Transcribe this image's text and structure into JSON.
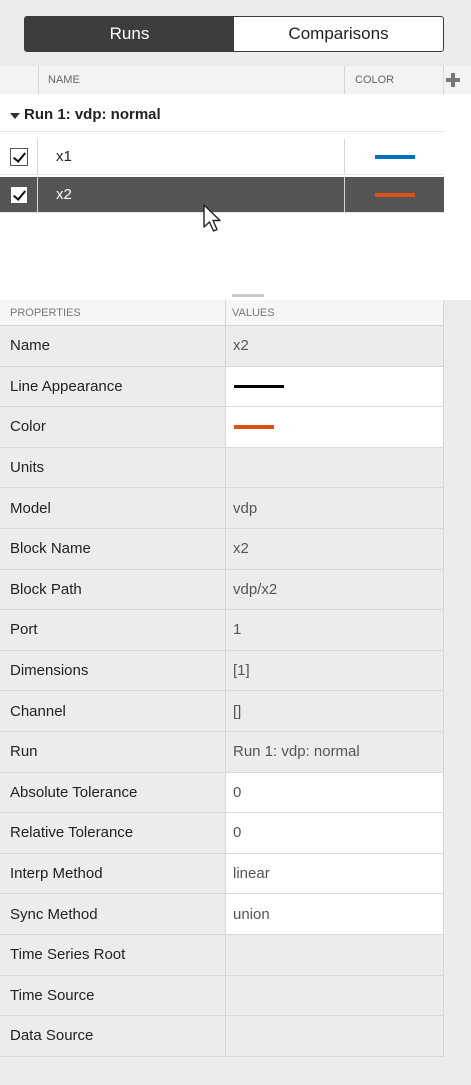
{
  "tabs": {
    "runs_label": "Runs",
    "comparisons_label": "Comparisons"
  },
  "signals": {
    "header_name": "NAME",
    "header_color": "COLOR",
    "run_label": "Run 1: vdp: normal",
    "rows": [
      {
        "name": "x1",
        "checked": true,
        "color": "#0072bd",
        "selected": false
      },
      {
        "name": "x2",
        "checked": true,
        "color": "#d95319",
        "selected": true
      }
    ]
  },
  "properties": {
    "header_properties": "PROPERTIES",
    "header_values": "VALUES",
    "rows": [
      {
        "name": "Name",
        "value": "x2",
        "editable": false
      },
      {
        "name": "Line Appearance",
        "value": "",
        "editable": true,
        "kind": "line",
        "line_color": "#000000"
      },
      {
        "name": "Color",
        "value": "",
        "editable": true,
        "kind": "color",
        "color": "#d95319"
      },
      {
        "name": "Units",
        "value": "",
        "editable": false
      },
      {
        "name": "Model",
        "value": "vdp",
        "editable": false
      },
      {
        "name": "Block Name",
        "value": "x2",
        "editable": false
      },
      {
        "name": "Block Path",
        "value": "vdp/x2",
        "editable": false
      },
      {
        "name": "Port",
        "value": "1",
        "editable": false
      },
      {
        "name": "Dimensions",
        "value": "[1]",
        "editable": false
      },
      {
        "name": "Channel",
        "value": "[]",
        "editable": false
      },
      {
        "name": "Run",
        "value": "Run 1: vdp: normal",
        "editable": false
      },
      {
        "name": "Absolute Tolerance",
        "value": "0",
        "editable": true
      },
      {
        "name": "Relative Tolerance",
        "value": "0",
        "editable": true
      },
      {
        "name": "Interp Method",
        "value": "linear",
        "editable": true
      },
      {
        "name": "Sync Method",
        "value": "union",
        "editable": true
      },
      {
        "name": "Time Series Root",
        "value": "",
        "editable": false
      },
      {
        "name": "Time Source",
        "value": "",
        "editable": false
      },
      {
        "name": "Data Source",
        "value": "",
        "editable": false
      }
    ]
  }
}
